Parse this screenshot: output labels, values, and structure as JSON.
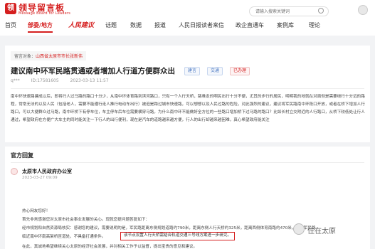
{
  "header": {
    "logo_mark": "领",
    "logo_text": "领导留言板",
    "logo_sub": "Message Board for Leaders",
    "search_placeholder": "请输入搜索关键词"
  },
  "nav": {
    "items": [
      "首页",
      "部委/地方",
      "人民建议",
      "话题",
      "数据",
      "报道",
      "人民日报读者来信",
      "政企直通车",
      "案例库",
      "理论"
    ]
  },
  "post": {
    "crumb_label": "留言对象：",
    "crumb_value": "山西省太原市市长张新伟",
    "title": "建议南中环军民路贯通或者增加人行道方便群众出",
    "tags": [
      "建言",
      "交通",
      "已办理"
    ],
    "author": "q***",
    "id": "ID:17581605",
    "date": "2023-03-13 11:57",
    "body": "南中环快速路建成以后，即将行人过马路的路口十分少，从南中环体育路到滨河路口，只有一个人行天桥，路难走的啊民出行十分不便，尤其的步行的居民，明明我的地就在对面但是需要绕行十分远的路程，常常无法的以及人民（包括老人，需要不能遵行走人推行电动车出行）被迫是跨过城市快速路，可以想想以及人民过路的危险，对此强烈的建议，建议将军民路南中环段口开放，或者在桥下增加人行路口，可以大便群众过马路，南中环桥下有停车位，车主停车后车位需要横穿马路，为什么南中环不能做好全方位的一些路口增加桥下过马路的路口？比如长村立交附近的人行路口，从桥下较低处让行人通过，希望政府在方便广大车主的同时能关注一下行人的出行便利，现在是汽车的道路越来越方便，行人的出行却越来越困难，真心希望政府能关注"
  },
  "reply": {
    "heading": "官方回复",
    "dept": "太原市人民政府办公室",
    "date": "2023-03-27 09:09",
    "greeting": "热心网友您好！",
    "line1": "首先非常感谢您对太原市社会事业发展的关心。现就您提问题答复如下：",
    "line2": "经市规划和自然资源局核实：感谢您的建议，需要说明的是，军民路距离东侧规划道路约790米，距离东侧人行天桥约325米，距离西侧体育南路约470米，由于军民路",
    "line3a": "临近南中环南高架桥匝道处，不具备打通条件。",
    "line3b": "该节点设置人行天桥需结合轨道交通三号线方案进一步研究。",
    "line4": "在此，真诚地希望继续关心太原的经济社会发展，并对相关工作予以监督，提出宝贵的意见和建议。"
  },
  "watermark": {
    "text": "住在太原"
  }
}
